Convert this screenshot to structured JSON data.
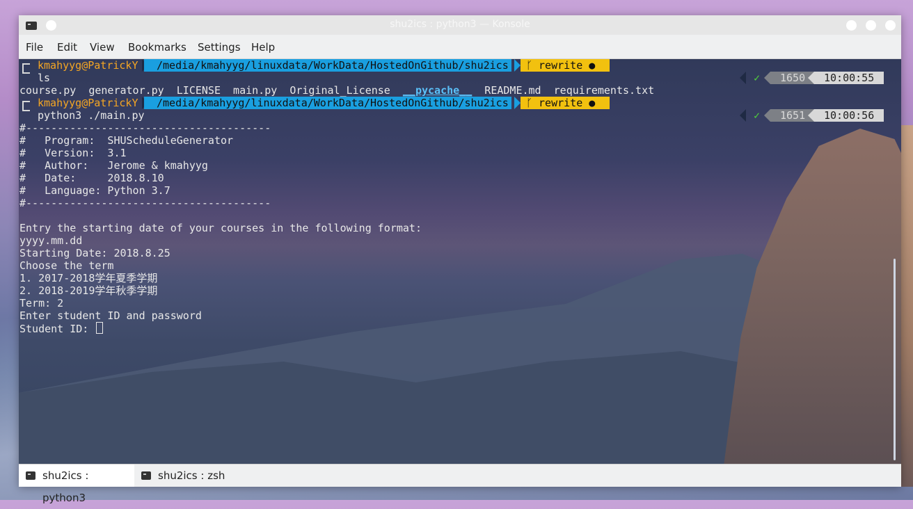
{
  "window": {
    "title": "shu2ics : python3 — Konsole",
    "menu": [
      "File",
      "Edit",
      "View",
      "Bookmarks",
      "Settings",
      "Help"
    ]
  },
  "prompts": [
    {
      "user": "kmahyyg@PatrickY",
      "path": "/media/kmahyyg/linuxdata/WorkData/HostedOnGithub/shu2ics",
      "branch": "rewrite",
      "branch_icon": "git-branch-icon",
      "dirty": "●",
      "command": "ls",
      "status": "✓",
      "history": "1650",
      "time": "10:00:55"
    },
    {
      "user": "kmahyyg@PatrickY",
      "path": "/media/kmahyyg/linuxdata/WorkData/HostedOnGithub/shu2ics",
      "branch": "rewrite",
      "branch_icon": "git-branch-icon",
      "dirty": "●",
      "command": "python3 ./main.py",
      "status": "✓",
      "history": "1651",
      "time": "10:00:56"
    }
  ],
  "ls_output": {
    "before": "course.py  generator.py  LICENSE  main.py  Original_License  ",
    "dir": "__pycache__",
    "after": "  README.md  requirements.txt"
  },
  "output_lines": [
    "#---------------------------------------",
    "#   Program:  SHUScheduleGenerator",
    "#   Version:  3.1",
    "#   Author:   Jerome & kmahyyg",
    "#   Date:     2018.8.10",
    "#   Language: Python 3.7",
    "#---------------------------------------",
    "",
    "Entry the starting date of your courses in the following format:",
    "yyyy.mm.dd",
    "Starting Date: 2018.8.25",
    "Choose the term",
    "1. 2017-2018学年夏季学期",
    "2. 2018-2019学年秋季学期",
    "Term: 2",
    "Enter student ID and password"
  ],
  "input_prompt": "Student ID: ",
  "tabs": [
    {
      "label": "shu2ics : python3",
      "active": true
    },
    {
      "label": "shu2ics : zsh",
      "active": false
    }
  ],
  "colors": {
    "path_bg": "#1a9fe0",
    "git_bg": "#f2c10f",
    "user": "#f5a623",
    "check": "#4fd13b"
  }
}
